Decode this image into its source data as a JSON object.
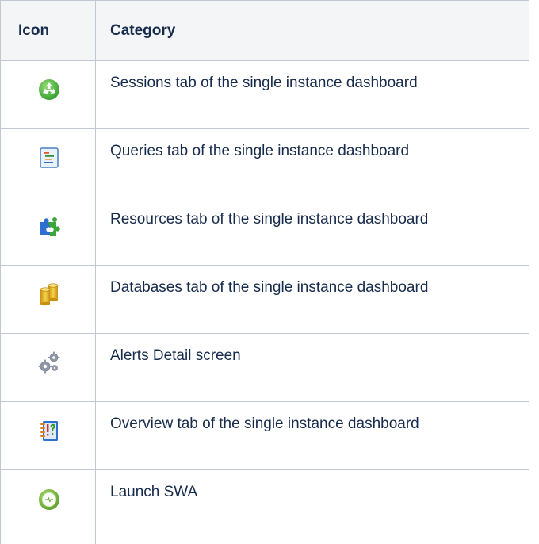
{
  "table": {
    "headers": {
      "icon": "Icon",
      "category": "Category"
    },
    "rows": [
      {
        "icon": "sessions-recycle-icon",
        "category": "Sessions tab of the single instance dashboard"
      },
      {
        "icon": "queries-document-icon",
        "category": "Queries tab of the single instance dashboard"
      },
      {
        "icon": "resources-puzzle-icon",
        "category": "Resources tab of the single instance dashboard"
      },
      {
        "icon": "databases-cylinder-icon",
        "category": "Databases tab of the single instance dashboard"
      },
      {
        "icon": "alerts-gears-icon",
        "category": "Alerts Detail screen"
      },
      {
        "icon": "overview-notebook-icon",
        "category": "Overview tab of the single instance dashboard"
      },
      {
        "icon": "launch-swa-icon",
        "category": "Launch SWA"
      }
    ]
  }
}
